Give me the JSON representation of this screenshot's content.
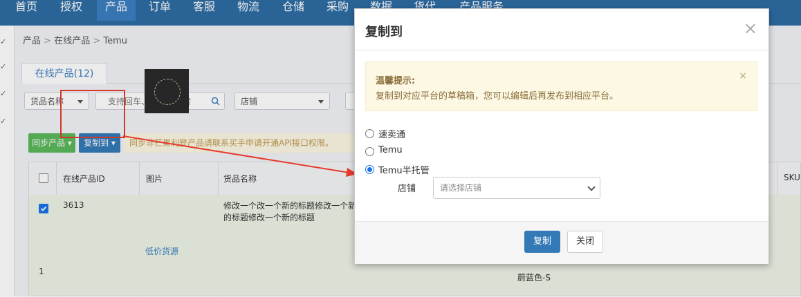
{
  "topnav": {
    "items": [
      "首页",
      "授权",
      "产品",
      "订单",
      "客服",
      "物流",
      "仓储",
      "采购",
      "数据",
      "货代",
      "产品服务"
    ],
    "active_index": 2
  },
  "breadcrumb": {
    "parts": [
      "产品",
      ">",
      "在线产品",
      ">",
      "Temu"
    ]
  },
  "tabs": {
    "online_products": "在线产品(12)"
  },
  "filters": {
    "name_select": "货品名称",
    "search_placeholder": "支持回车、扫描枪搜索",
    "store_select": "店铺"
  },
  "toolbar": {
    "sync_label": "同步产品",
    "copy_to_label": "复制到",
    "notice": "同步非芒果利登产品请联系买手申请开通API接口权限。"
  },
  "table": {
    "headers": [
      "在线产品ID",
      "图片",
      "货品名称",
      "SKU"
    ],
    "row": {
      "id": "3613",
      "name": "修改一个改一个新的标题修改一个新的标题修改一个新的标题",
      "link": "低价货源",
      "index": "1",
      "variant": "蔚蓝色-S"
    }
  },
  "modal": {
    "title": "复制到",
    "close_glyph": "×",
    "alert": {
      "title": "温馨提示:",
      "text": "复制到对应平台的草稿箱，您可以编辑后再发布到相应平台。",
      "close_glyph": "×"
    },
    "options": [
      {
        "label": "速卖通",
        "checked": false
      },
      {
        "label": "Temu",
        "checked": false
      },
      {
        "label": "Temu半托管",
        "checked": true
      }
    ],
    "store_label": "店铺",
    "store_placeholder": "请选择店铺",
    "copy_button": "复制",
    "close_button": "关闭"
  },
  "colors": {
    "nav_bg": "#2e6da4",
    "primary": "#337ab7",
    "success": "#5cb85c",
    "annotation_red": "#e63b2e",
    "alert_bg": "#fcf8e3",
    "row_highlight": "#edf4e7"
  }
}
